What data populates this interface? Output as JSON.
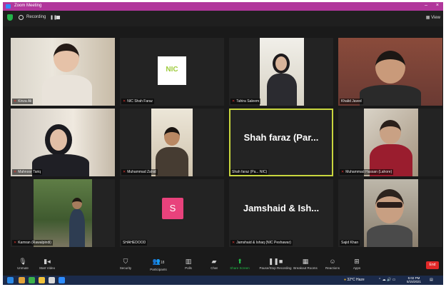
{
  "window": {
    "title": "Zoom Meeting",
    "minimize": "–",
    "close": "×"
  },
  "topbar": {
    "recording_label": "Recording",
    "pause": "❚❚",
    "view_label": "View"
  },
  "tiles": [
    {
      "name": "Kinza Ali",
      "kind": "video"
    },
    {
      "name": "NIC Shah Faraz",
      "kind": "logo",
      "logo_text": "NIC"
    },
    {
      "name": "Tahira Saleem",
      "kind": "video"
    },
    {
      "name": "Khalid Javed",
      "kind": "video"
    },
    {
      "name": "Mahnoor Tariq",
      "kind": "video"
    },
    {
      "name": "Muhammad Zahid",
      "kind": "video"
    },
    {
      "name": "Shah faraz (Pa... NIC)",
      "kind": "text",
      "display": "Shah faraz (Par..."
    },
    {
      "name": "Muhammad Hassan (Lahore)",
      "kind": "video"
    },
    {
      "name": "Kamran (Rawalpindi)",
      "kind": "video"
    },
    {
      "name": "SHAHEDOOD",
      "kind": "avatar",
      "letter": "S"
    },
    {
      "name": "Jamshaid & Ishaq (NIC Peshawar)",
      "kind": "text",
      "display": "Jamshaid & Ish..."
    },
    {
      "name": "Sajid Khan",
      "kind": "video"
    }
  ],
  "toolbar": {
    "unmute": "Unmute",
    "start_video": "Start Video",
    "security": "Security",
    "participants": "Participants",
    "participants_count": "18",
    "polls": "Polls",
    "chat": "Chat",
    "share_screen": "Share Screen",
    "record": "Pause/Stop Recording",
    "breakout": "Breakout Rooms",
    "reactions": "Reactions",
    "apps": "Apps",
    "end": "End"
  },
  "taskbar": {
    "weather": "32°C Haze",
    "time": "5:02 PM",
    "date": "5/15/2021"
  },
  "colors": {
    "titlebar": "#b1379b",
    "tile_bg": "#232323",
    "active_outline": "#c9d63e",
    "avatar_pink": "#e8427c",
    "nic_green": "#9ecb3c",
    "end_red": "#e02828",
    "taskbar": "#1b2a4a"
  }
}
